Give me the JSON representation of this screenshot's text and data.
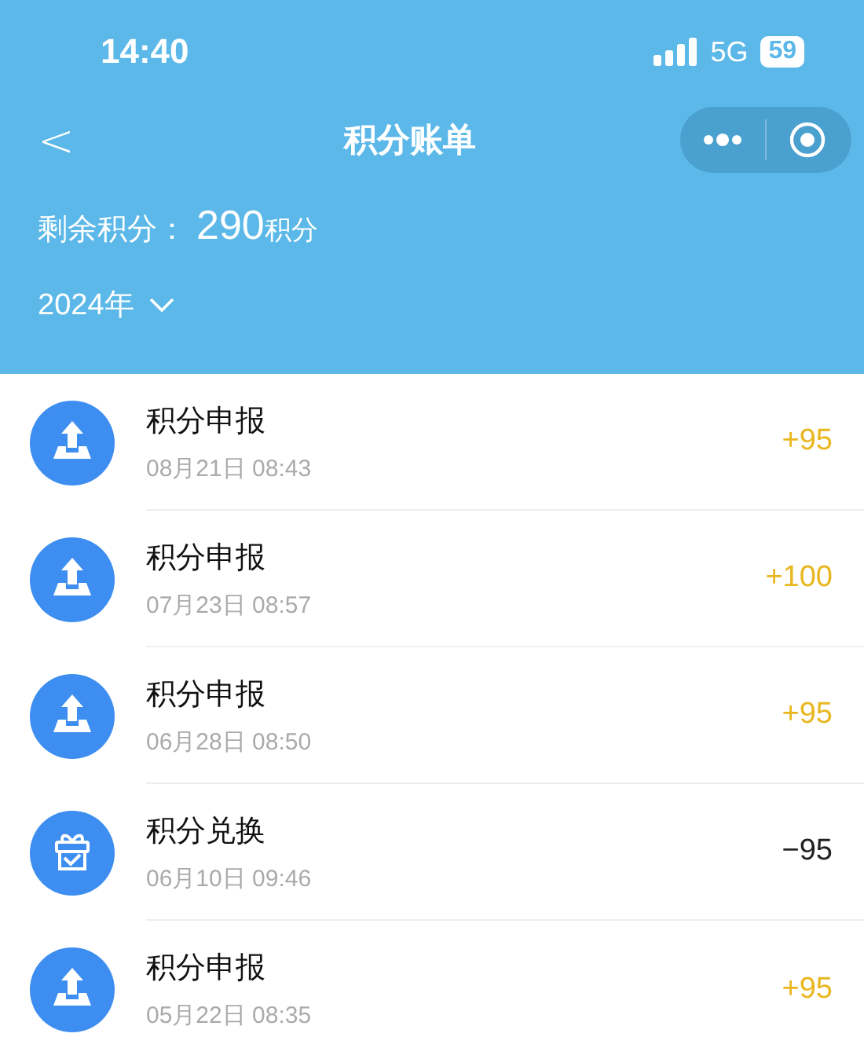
{
  "status_bar": {
    "time": "14:40",
    "network": "5G",
    "battery": "59"
  },
  "nav": {
    "back": "<",
    "title": "积分账单"
  },
  "balance": {
    "label": "剩余积分：",
    "value": "290",
    "unit": "积分"
  },
  "year_filter": {
    "label": "2024年"
  },
  "records": [
    {
      "kind": "report",
      "title": "积分申报",
      "time": "08月21日 08:43",
      "amount": "+95"
    },
    {
      "kind": "report",
      "title": "积分申报",
      "time": "07月23日 08:57",
      "amount": "+100"
    },
    {
      "kind": "report",
      "title": "积分申报",
      "time": "06月28日 08:50",
      "amount": "+95"
    },
    {
      "kind": "exchange",
      "title": "积分兑换",
      "time": "06月10日 09:46",
      "amount": "−95"
    },
    {
      "kind": "report",
      "title": "积分申报",
      "time": "05月22日 08:35",
      "amount": "+95"
    }
  ]
}
